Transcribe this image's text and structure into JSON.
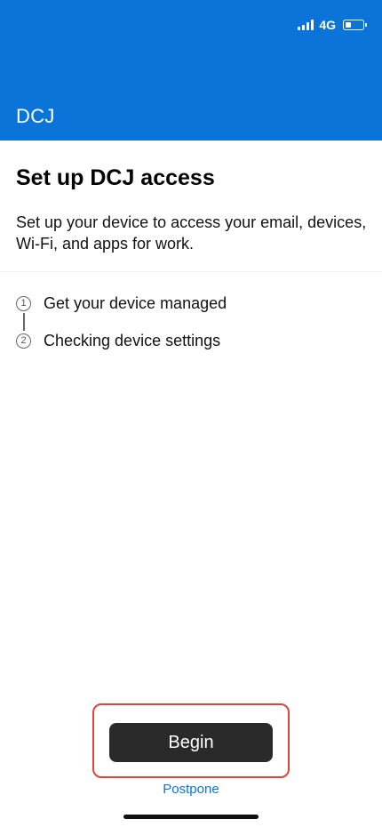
{
  "status_bar": {
    "network": "4G",
    "signal_bars": 4,
    "battery_level": 0.35
  },
  "header": {
    "org_name": "DCJ",
    "background_color": "#0b74d8"
  },
  "main": {
    "title": "Set up DCJ access",
    "description": "Set up your device to access your email, devices, Wi-Fi, and apps for work.",
    "steps": [
      {
        "number": "1",
        "label": "Get your device managed"
      },
      {
        "number": "2",
        "label": "Checking device settings"
      }
    ]
  },
  "actions": {
    "begin_label": "Begin",
    "postpone_label": "Postpone",
    "highlight_color": "#e0453a",
    "link_color": "#0b74d8"
  }
}
